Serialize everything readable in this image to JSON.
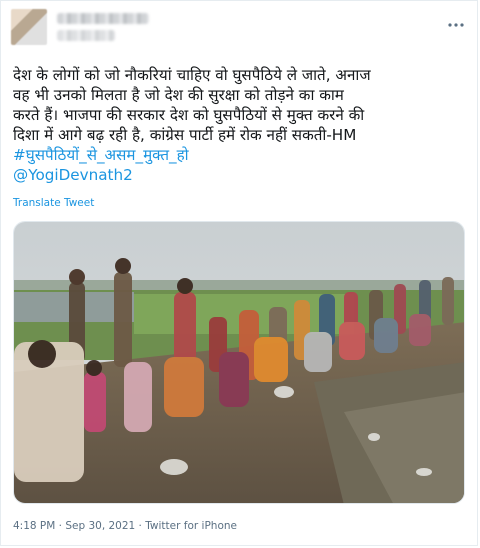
{
  "tweet": {
    "lines": [
      "देश के लोगों को जो नौकरियां चाहिए वो घुसपैठिये ले जाते, अनाज",
      "वह भी उनको मिलता है जो देश की सुरक्षा को तोड़ने का काम",
      "करते हैं। भाजपा की सरकार देश को घुसपैठियों से मुक्त करने की",
      "दिशा में आगे बढ़ रही है, कांग्रेस पार्टी हमें रोक नहीं सकती-HM"
    ],
    "hashtag": "#घुसपैठियों_से_असम_मुक्त_हो",
    "mention": "@YogiDevnath2",
    "translate_label": "Translate Tweet"
  },
  "photo": {
    "alt": ""
  },
  "meta": {
    "time": "4:18 PM",
    "separator1": " · ",
    "date": "Sep 30, 2021",
    "separator2": " · ",
    "source": "Twitter for iPhone"
  },
  "icons": {
    "more": "more-horizontal-icon"
  },
  "colors": {
    "link": "#1b95e0",
    "text": "#14171a",
    "muted": "#5b7083"
  }
}
